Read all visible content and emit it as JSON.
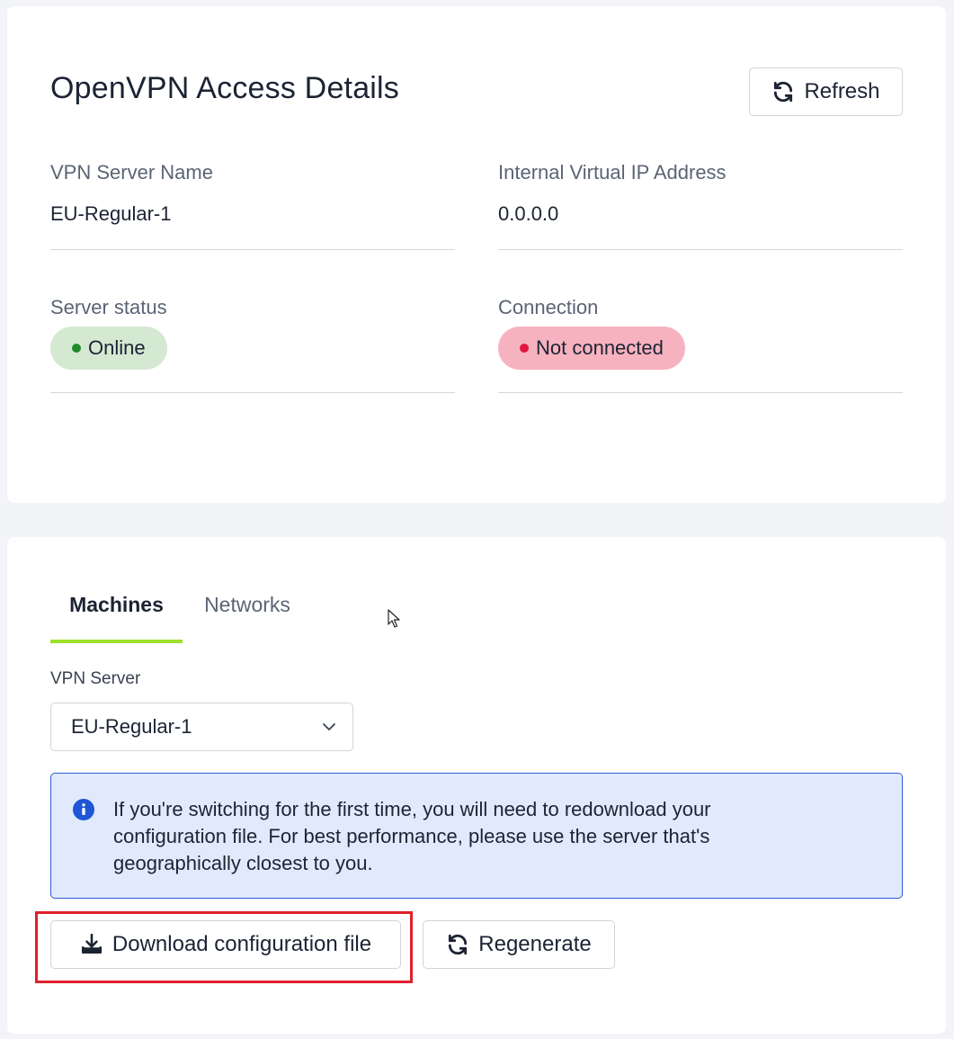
{
  "access_card": {
    "title": "OpenVPN Access Details",
    "refresh_label": "Refresh",
    "fields": {
      "server_name_label": "VPN Server Name",
      "server_name_value": "EU-Regular-1",
      "ip_label": "Internal Virtual IP Address",
      "ip_value": "0.0.0.0",
      "status_label": "Server status",
      "status_value": "Online",
      "connection_label": "Connection",
      "connection_value": "Not connected"
    }
  },
  "config_card": {
    "tabs": [
      {
        "label": "Machines",
        "active": true
      },
      {
        "label": "Networks",
        "active": false
      }
    ],
    "vpn_server_label": "VPN Server",
    "vpn_server_selected": "EU-Regular-1",
    "info_text": "If you're switching for the first time, you will need to redownload your configuration file. For best performance, please use the server that's geographically closest to you.",
    "download_label": "Download configuration file",
    "regenerate_label": "Regenerate"
  },
  "colors": {
    "accent_tab": "#9fe02d",
    "online_bg": "#d5e8d2",
    "online_dot": "#1f8b2a",
    "not_connected_bg": "#f7b2c0",
    "not_connected_dot": "#e3163f",
    "info_bg": "#e1eafd",
    "info_border": "#2c5fd0",
    "highlight": "#e0202c"
  },
  "icons": {
    "refresh": "refresh-icon",
    "download": "download-icon",
    "regenerate": "regenerate-icon",
    "info": "info-icon",
    "dropdown": "chevron-down-icon"
  }
}
